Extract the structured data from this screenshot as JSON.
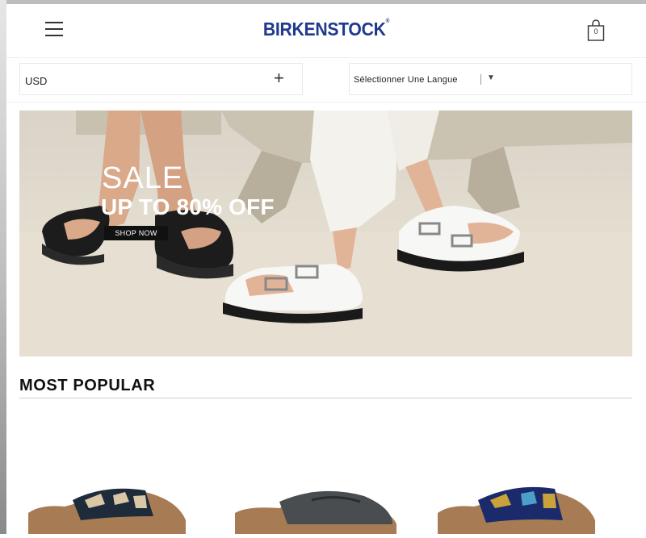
{
  "header": {
    "logo": "BIRKENSTOCK",
    "logo_mark": "®",
    "cart_count": "0"
  },
  "selectors": {
    "currency_value": "USD",
    "currency_toggle": "+",
    "language_value": "Sélectionner Une Langue",
    "language_arrow": "▼"
  },
  "hero": {
    "line1": "SALE",
    "line2": "UP TO 80% OFF",
    "cta": "SHOP NOW"
  },
  "section": {
    "title": "MOST POPULAR"
  },
  "colors": {
    "logo": "#1f3a8c",
    "text": "#111111",
    "cta_bg": "#111111"
  },
  "icons": {
    "menu": "hamburger-menu-icon",
    "cart": "shopping-bag-icon"
  }
}
